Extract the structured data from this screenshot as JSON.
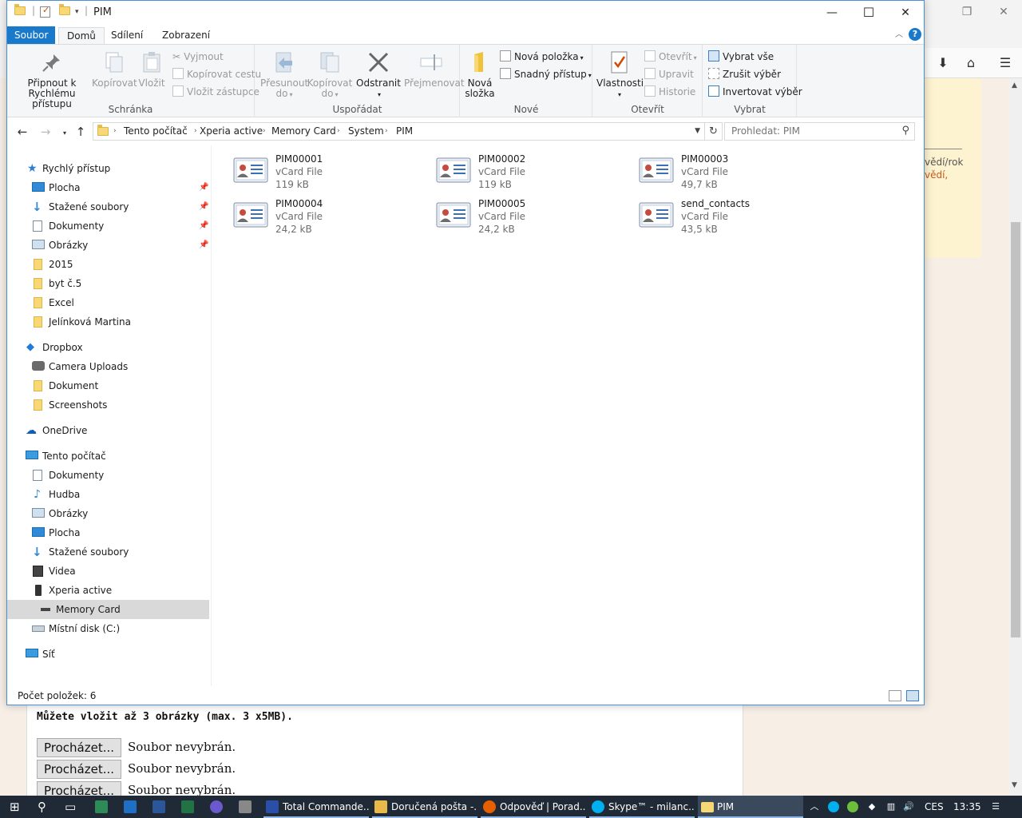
{
  "window": {
    "title": "PIM",
    "controls": {
      "minimize": "—",
      "maximize": "☐",
      "close": "✕"
    }
  },
  "ribbon": {
    "tabs": [
      "Soubor",
      "Domů",
      "Sdílení",
      "Zobrazení"
    ],
    "help": "?",
    "groups": {
      "clipboard": {
        "label": "Schránka",
        "pin": "Připnout k\nRychlému přístupu",
        "pin_l1": "Připnout k",
        "pin_l2": "Rychlému přístupu",
        "copy": "Kopírovat",
        "paste": "Vložit",
        "cut": "Vyjmout",
        "copy_path": "Kopírovat cestu",
        "paste_shortcut": "Vložit zástupce"
      },
      "organize": {
        "label": "Uspořádat",
        "move_l1": "Přesunout",
        "move_l2": "do",
        "copy_l1": "Kopírovat",
        "copy_l2": "do",
        "delete": "Odstranit",
        "rename": "Přejmenovat"
      },
      "new": {
        "label": "Nové",
        "new_folder_l1": "Nová",
        "new_folder_l2": "složka",
        "new_item": "Nová položka",
        "easy_access": "Snadný přístup"
      },
      "open": {
        "label": "Otevřít",
        "properties": "Vlastnosti",
        "open": "Otevřít",
        "edit": "Upravit",
        "history": "Historie"
      },
      "select": {
        "label": "Vybrat",
        "select_all": "Vybrat vše",
        "select_none": "Zrušit výběr",
        "invert": "Invertovat výběr"
      }
    }
  },
  "address": {
    "crumbs": [
      "Tento počítač",
      "Xperia active",
      "Memory Card",
      "System",
      "PIM"
    ],
    "search_placeholder": "Prohledat: PIM"
  },
  "nav": {
    "quick_access": "Rychlý přístup",
    "quick_items": [
      "Plocha",
      "Stažené soubory",
      "Dokumenty",
      "Obrázky",
      "2015",
      "byt č.5",
      "Excel",
      "Jelínková Martina"
    ],
    "dropbox": "Dropbox",
    "dropbox_items": [
      "Camera Uploads",
      "Dokument",
      "Screenshots"
    ],
    "onedrive": "OneDrive",
    "this_pc": "Tento počítač",
    "pc_items": [
      "Dokumenty",
      "Hudba",
      "Obrázky",
      "Plocha",
      "Stažené soubory",
      "Videa",
      "Xperia active"
    ],
    "memory_card": "Memory Card",
    "local_disk": "Místní disk (C:)",
    "network": "Síť"
  },
  "files": [
    {
      "name": "PIM00001",
      "type": "vCard File",
      "size": "119 kB"
    },
    {
      "name": "PIM00002",
      "type": "vCard File",
      "size": "119 kB"
    },
    {
      "name": "PIM00003",
      "type": "vCard File",
      "size": "49,7 kB"
    },
    {
      "name": "PIM00004",
      "type": "vCard File",
      "size": "24,2 kB"
    },
    {
      "name": "PIM00005",
      "type": "vCard File",
      "size": "24,2 kB"
    },
    {
      "name": "send_contacts",
      "type": "vCard File",
      "size": "43,5 kB"
    }
  ],
  "status": {
    "count": "Počet položek: 6"
  },
  "background_page": {
    "side_text_1": "vědí/rok",
    "side_text_2": "vědí,",
    "upload_title": "Můžete vložit až 3 obrázky (max. 3 x5MB).",
    "browse_label": "Procházet...",
    "no_file": "Soubor nevybrán."
  },
  "taskbar": {
    "apps": [
      "Total Commande...",
      "Doručená pošta -...",
      "Odpověď | Porad...",
      "Skype™ - milanc...",
      "PIM"
    ],
    "lang": "CES",
    "time": "13:35"
  },
  "colors": {
    "accent": "#1979ca",
    "folder": "#f8d775",
    "selection": "#d9d9d9",
    "taskbar": "#1f2a36"
  }
}
